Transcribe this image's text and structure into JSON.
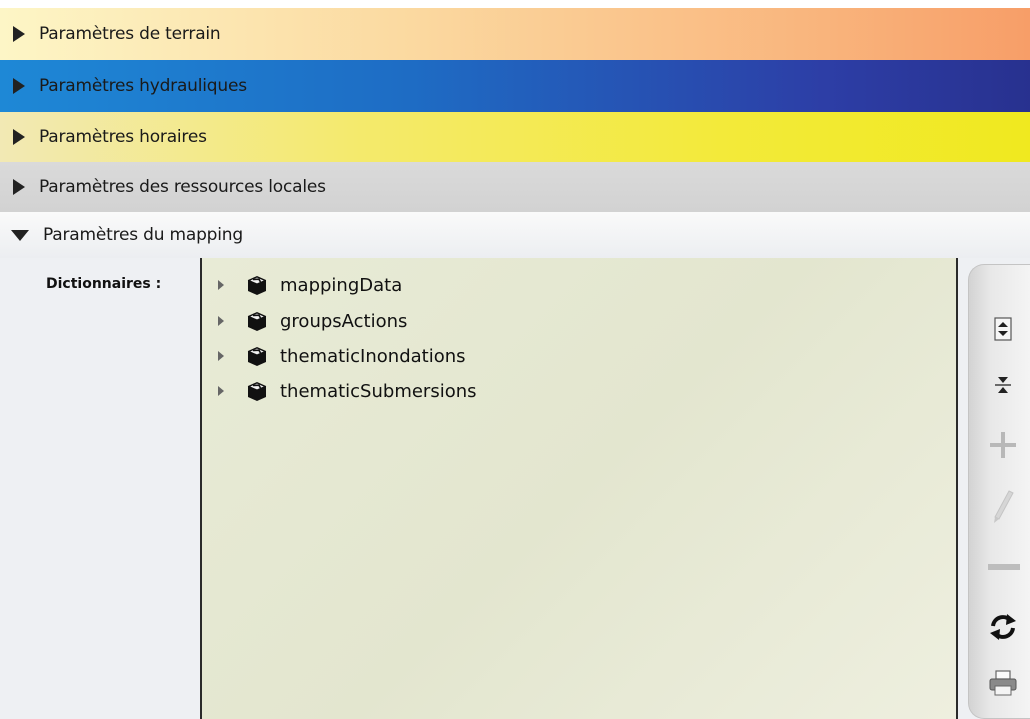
{
  "sections": [
    {
      "label": "Paramètres de terrain",
      "expanded": false
    },
    {
      "label": "Paramètres hydrauliques",
      "expanded": false
    },
    {
      "label": "Paramètres horaires",
      "expanded": false
    },
    {
      "label": "Paramètres des ressources locales",
      "expanded": false
    },
    {
      "label": "Paramètres du mapping",
      "expanded": true
    }
  ],
  "mapping": {
    "dictionaries_label": "Dictionnaires :",
    "dictionaries": [
      {
        "label": "mappingData",
        "icon": "dictionary-icon"
      },
      {
        "label": "groupsActions",
        "icon": "dictionary-icon"
      },
      {
        "label": "thematicInondations",
        "icon": "dictionary-icon"
      },
      {
        "label": "thematicSubmersions",
        "icon": "dictionary-icon"
      }
    ]
  },
  "toolbar": {
    "buttons": [
      {
        "icon": "expand-all-icon",
        "enabled": true
      },
      {
        "icon": "collapse-all-icon",
        "enabled": true
      },
      {
        "icon": "add-icon",
        "enabled": false
      },
      {
        "icon": "edit-icon",
        "enabled": false
      },
      {
        "icon": "remove-icon",
        "enabled": false
      },
      {
        "icon": "refresh-icon",
        "enabled": true
      },
      {
        "icon": "print-icon",
        "enabled": true
      }
    ]
  },
  "colors": {
    "terrain_gradient": [
      "#fdf6c6",
      "#f79e68"
    ],
    "hydraulic_gradient": [
      "#1e88d6",
      "#28318f"
    ],
    "horaires_gradient": [
      "#f2e9b4",
      "#f0e91f"
    ],
    "ressources_bg": "#d6d6d6",
    "tree_bg": "#e6e9d3"
  }
}
